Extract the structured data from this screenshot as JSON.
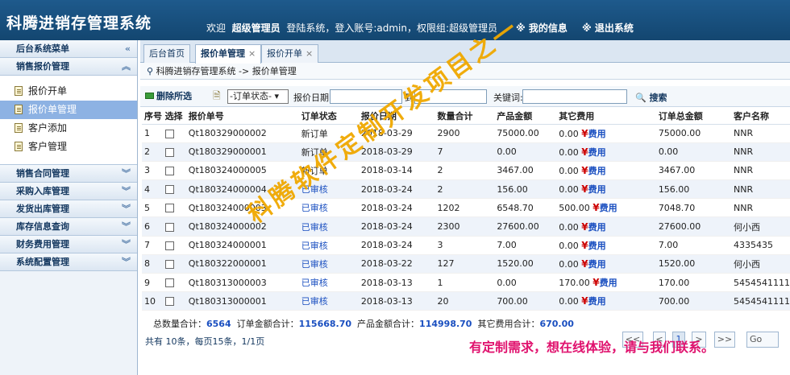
{
  "header": {
    "title": "科腾进销存管理系统",
    "welcome_prefix": "欢迎",
    "user_name": "超级管理员",
    "login_text": "登陆系统，登入账号:admin，权限组:超级管理员",
    "my_info": "※ 我的信息",
    "logout": "※ 退出系统"
  },
  "sidebar": {
    "menu_title": "后台系统菜单",
    "groups": [
      {
        "label": "销售报价管理",
        "expanded": true,
        "items": [
          "报价开单",
          "报价单管理",
          "客户添加",
          "客户管理"
        ]
      },
      {
        "label": "销售合同管理"
      },
      {
        "label": "采购入库管理"
      },
      {
        "label": "发货出库管理"
      },
      {
        "label": "库存信息查询"
      },
      {
        "label": "财务费用管理"
      },
      {
        "label": "系统配置管理"
      }
    ],
    "active_item": "报价单管理"
  },
  "tabs": [
    {
      "label": "后台首页",
      "closable": false
    },
    {
      "label": "报价单管理",
      "closable": true,
      "active": true
    },
    {
      "label": "报价开单",
      "closable": true
    }
  ],
  "breadcrumb": "科腾进销存管理系统 -> 报价单管理",
  "toolbar": {
    "delete_label": "删除所选",
    "status_select": "-订单状态-",
    "date_label": "报价日期:",
    "to_label": "到",
    "keyword_label": "关键词:",
    "search_label": "搜索"
  },
  "table": {
    "columns": [
      "序号",
      "选择",
      "报价单号",
      "订单状态",
      "报价日期",
      "数量合计",
      "产品金额",
      "其它费用",
      "订单总金额",
      "客户名称"
    ],
    "fee_sign": "¥",
    "fee_link": "费用",
    "rows": [
      {
        "no": "1",
        "id": "Qt180329000002",
        "status": "新订单",
        "date": "2018-03-29",
        "qty": "2900",
        "amount": "75000.00",
        "other": "0.00",
        "total": "75000.00",
        "customer": "NNR"
      },
      {
        "no": "2",
        "id": "Qt180329000001",
        "status": "新订单",
        "date": "2018-03-29",
        "qty": "7",
        "amount": "0.00",
        "other": "0.00",
        "total": "0.00",
        "customer": "NNR"
      },
      {
        "no": "3",
        "id": "Qt180324000005",
        "status": "新订单",
        "date": "2018-03-14",
        "qty": "2",
        "amount": "3467.00",
        "other": "0.00",
        "total": "3467.00",
        "customer": "NNR"
      },
      {
        "no": "4",
        "id": "Qt180324000004",
        "status": "已审核",
        "date": "2018-03-24",
        "qty": "2",
        "amount": "156.00",
        "other": "0.00",
        "total": "156.00",
        "customer": "NNR"
      },
      {
        "no": "5",
        "id": "Qt180324000003",
        "status": "已审核",
        "date": "2018-03-24",
        "qty": "1202",
        "amount": "6548.70",
        "other": "500.00",
        "total": "7048.70",
        "customer": "NNR"
      },
      {
        "no": "6",
        "id": "Qt180324000002",
        "status": "已审核",
        "date": "2018-03-24",
        "qty": "2300",
        "amount": "27600.00",
        "other": "0.00",
        "total": "27600.00",
        "customer": "何小西"
      },
      {
        "no": "7",
        "id": "Qt180324000001",
        "status": "已审核",
        "date": "2018-03-24",
        "qty": "3",
        "amount": "7.00",
        "other": "0.00",
        "total": "7.00",
        "customer": "4335435"
      },
      {
        "no": "8",
        "id": "Qt180322000001",
        "status": "已审核",
        "date": "2018-03-22",
        "qty": "127",
        "amount": "1520.00",
        "other": "0.00",
        "total": "1520.00",
        "customer": "何小西"
      },
      {
        "no": "9",
        "id": "Qt180313000003",
        "status": "已审核",
        "date": "2018-03-13",
        "qty": "1",
        "amount": "0.00",
        "other": "170.00",
        "total": "170.00",
        "customer": "5454541111"
      },
      {
        "no": "10",
        "id": "Qt180313000001",
        "status": "已审核",
        "date": "2018-03-13",
        "qty": "20",
        "amount": "700.00",
        "other": "0.00",
        "total": "700.00",
        "customer": "5454541111"
      }
    ]
  },
  "summary": {
    "qty_label": "总数量合计：",
    "qty": "6564",
    "order_label": "订单金额合计：",
    "order": "115668.70",
    "product_label": "产品金额合计：",
    "product": "114998.70",
    "other_label": "其它费用合计：",
    "other": "670.00"
  },
  "pagination": {
    "info": "共有 10条，每页15条，1/1页",
    "buttons": [
      "<<",
      "<",
      "1",
      ">",
      ">>"
    ],
    "current": "1",
    "go": "Go"
  },
  "watermark": "科腾软件定制开发项目之一",
  "contact_banner": "有定制需求，想在线体验，请与我们联系。",
  "colors": {
    "header_bg": "#134670",
    "active_menu": "#8db2e3",
    "watermark": "#f0a800",
    "banner": "#e0126e",
    "link": "#1a4fc0",
    "fee_sign": "#cc0000"
  }
}
